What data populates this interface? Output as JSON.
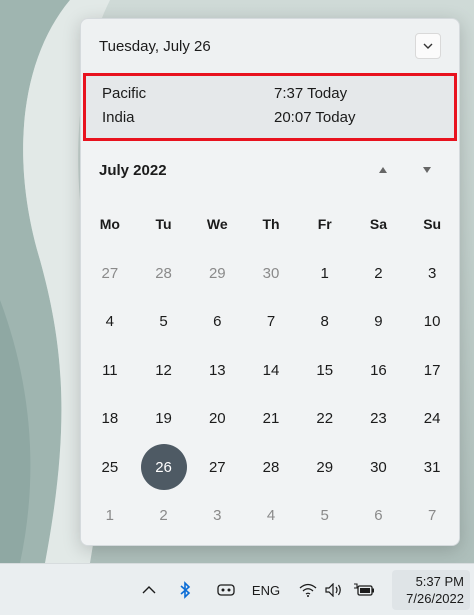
{
  "flyout": {
    "date_title": "Tuesday, July 26",
    "collapse_icon": "chevron-down-icon"
  },
  "clocks": [
    {
      "zone": "Pacific",
      "time": "7:37 Today"
    },
    {
      "zone": "India",
      "time": "20:07 Today"
    }
  ],
  "calendar": {
    "month_label": "July 2022",
    "weekdays": [
      "Mo",
      "Tu",
      "We",
      "Th",
      "Fr",
      "Sa",
      "Su"
    ],
    "weeks": [
      [
        {
          "d": "27",
          "other": true
        },
        {
          "d": "28",
          "other": true
        },
        {
          "d": "29",
          "other": true
        },
        {
          "d": "30",
          "other": true
        },
        {
          "d": "1"
        },
        {
          "d": "2"
        },
        {
          "d": "3"
        }
      ],
      [
        {
          "d": "4"
        },
        {
          "d": "5"
        },
        {
          "d": "6"
        },
        {
          "d": "7"
        },
        {
          "d": "8"
        },
        {
          "d": "9"
        },
        {
          "d": "10"
        }
      ],
      [
        {
          "d": "11"
        },
        {
          "d": "12"
        },
        {
          "d": "13"
        },
        {
          "d": "14"
        },
        {
          "d": "15"
        },
        {
          "d": "16"
        },
        {
          "d": "17"
        }
      ],
      [
        {
          "d": "18"
        },
        {
          "d": "19"
        },
        {
          "d": "20"
        },
        {
          "d": "21"
        },
        {
          "d": "22"
        },
        {
          "d": "23"
        },
        {
          "d": "24"
        }
      ],
      [
        {
          "d": "25"
        },
        {
          "d": "26",
          "today": true
        },
        {
          "d": "27"
        },
        {
          "d": "28"
        },
        {
          "d": "29"
        },
        {
          "d": "30"
        },
        {
          "d": "31"
        }
      ],
      [
        {
          "d": "1",
          "other": true
        },
        {
          "d": "2",
          "other": true
        },
        {
          "d": "3",
          "other": true
        },
        {
          "d": "4",
          "other": true
        },
        {
          "d": "5",
          "other": true
        },
        {
          "d": "6",
          "other": true
        },
        {
          "d": "7",
          "other": true
        }
      ]
    ]
  },
  "taskbar": {
    "language": "ENG",
    "time": "5:37 PM",
    "date": "7/26/2022",
    "icons": [
      "chevron-up-icon",
      "bluetooth-icon",
      "meet-icon",
      "wifi-icon",
      "volume-icon",
      "battery-icon"
    ]
  },
  "colors": {
    "highlight_border": "#e8121e",
    "today_circle": "#4e5a64",
    "bluetooth": "#0a6cd6"
  }
}
